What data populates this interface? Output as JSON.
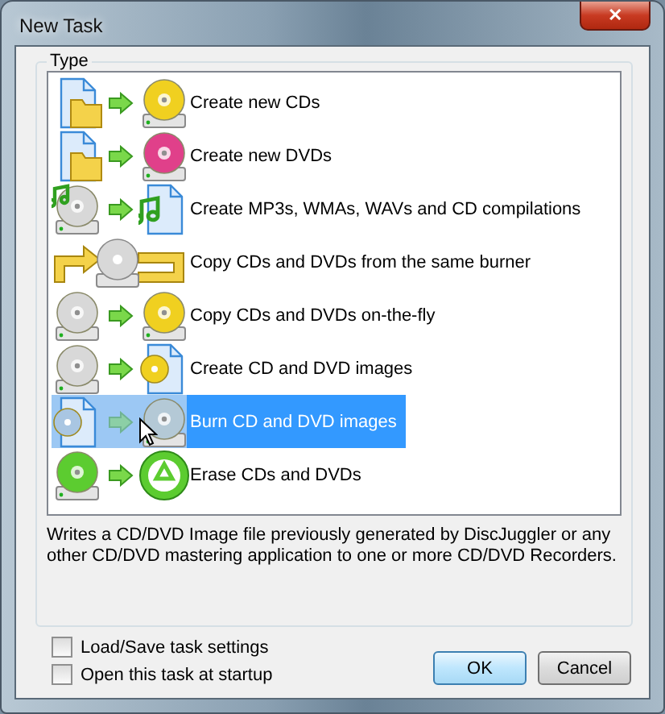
{
  "window": {
    "title": "New Task",
    "close": "✕"
  },
  "group": {
    "title": "Type"
  },
  "tasks": [
    {
      "label": "Create new CDs",
      "selected": false,
      "source": {
        "kind": "files"
      },
      "target": {
        "kind": "drive",
        "color": "#f0d020"
      }
    },
    {
      "label": "Create new DVDs",
      "selected": false,
      "source": {
        "kind": "files"
      },
      "target": {
        "kind": "drive",
        "color": "#e0408a"
      }
    },
    {
      "label": "Create MP3s, WMAs, WAVs and CD compilations",
      "selected": false,
      "source": {
        "kind": "music-drive",
        "color": "#d8d8d8"
      },
      "target": {
        "kind": "music-file"
      }
    },
    {
      "label": "Copy CDs and DVDs from the same burner",
      "selected": false,
      "source": {
        "kind": "loop",
        "color": "#d8d8d8"
      }
    },
    {
      "label": "Copy CDs and DVDs on-the-fly",
      "selected": false,
      "source": {
        "kind": "drive",
        "color": "#d8d8d8"
      },
      "target": {
        "kind": "drive",
        "color": "#f0d020"
      }
    },
    {
      "label": "Create CD and DVD images",
      "selected": false,
      "source": {
        "kind": "drive",
        "color": "#d8d8d8"
      },
      "target": {
        "kind": "image-file",
        "color": "#f0d020"
      }
    },
    {
      "label": "Burn CD and DVD images",
      "selected": true,
      "source": {
        "kind": "image-file",
        "color": "#a9c6e2"
      },
      "target": {
        "kind": "drive",
        "color": "#b4c9d6"
      }
    },
    {
      "label": "Erase CDs and DVDs",
      "selected": false,
      "source": {
        "kind": "drive",
        "color": "#5ccc30"
      },
      "target": {
        "kind": "recycle-disc",
        "color": "#5ccc30"
      }
    }
  ],
  "description": "Writes a CD/DVD Image file previously generated by DiscJuggler or any other CD/DVD mastering application to one or more CD/DVD Recorders.",
  "options": [
    {
      "label": "Load/Save task settings",
      "checked": false
    },
    {
      "label": "Open this task at startup",
      "checked": false
    }
  ],
  "buttons": [
    {
      "label": "OK",
      "kind": "default"
    },
    {
      "label": "Cancel",
      "kind": "normal"
    }
  ]
}
